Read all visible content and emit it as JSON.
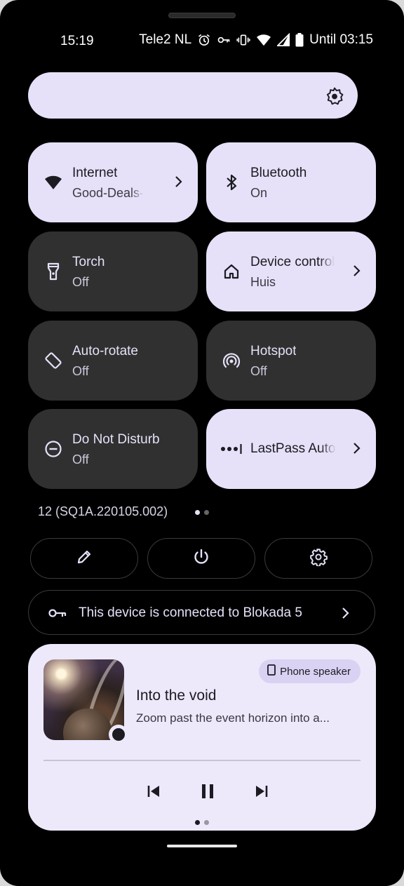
{
  "status_bar": {
    "time": "15:19",
    "carrier": "Tele2 NL",
    "battery_text": "Until 03:15",
    "icons": [
      "alarm-icon",
      "vpn-key-icon",
      "vibrate-icon",
      "wifi-icon",
      "signal-icon",
      "battery-icon"
    ]
  },
  "brightness": {
    "icon": "brightness-icon"
  },
  "tiles": [
    {
      "label": "Internet",
      "sub": "Good-Deals-",
      "state": "on",
      "icon": "wifi-icon",
      "chevron": true
    },
    {
      "label": "Bluetooth",
      "sub": "On",
      "state": "on",
      "icon": "bluetooth-icon",
      "chevron": false
    },
    {
      "label": "Torch",
      "sub": "Off",
      "state": "off",
      "icon": "torch-icon",
      "chevron": false
    },
    {
      "label": "Device controls",
      "sub": "Huis",
      "state": "on",
      "icon": "home-icon",
      "chevron": true
    },
    {
      "label": "Auto-rotate",
      "sub": "Off",
      "state": "off",
      "icon": "rotate-icon",
      "chevron": false
    },
    {
      "label": "Hotspot",
      "sub": "Off",
      "state": "off",
      "icon": "hotspot-icon",
      "chevron": false
    },
    {
      "label": "Do Not Disturb",
      "sub": "Off",
      "state": "off",
      "icon": "dnd-icon",
      "chevron": false
    },
    {
      "label": "LastPass Autofill",
      "sub": "",
      "state": "on",
      "icon": "password-icon",
      "chevron": true
    }
  ],
  "build_number": "12 (SQ1A.220105.002)",
  "pages": {
    "count": 2,
    "active": 0
  },
  "actions": [
    {
      "icon": "edit-icon"
    },
    {
      "icon": "power-icon"
    },
    {
      "icon": "settings-icon"
    }
  ],
  "vpn_notice": {
    "text": "This device is connected to Blokada 5",
    "icon": "vpn-key-icon"
  },
  "media": {
    "output_chip": "Phone speaker",
    "title": "Into the void",
    "subtitle": "Zoom past the event horizon into a...",
    "progress": 0,
    "controls": [
      "previous-icon",
      "pause-icon",
      "next-icon"
    ],
    "pages": {
      "count": 2,
      "active": 0
    }
  },
  "colors": {
    "tile_on": "#e6e1f8",
    "tile_off": "#303030",
    "media_card": "#ede9fb",
    "background": "#000000"
  }
}
